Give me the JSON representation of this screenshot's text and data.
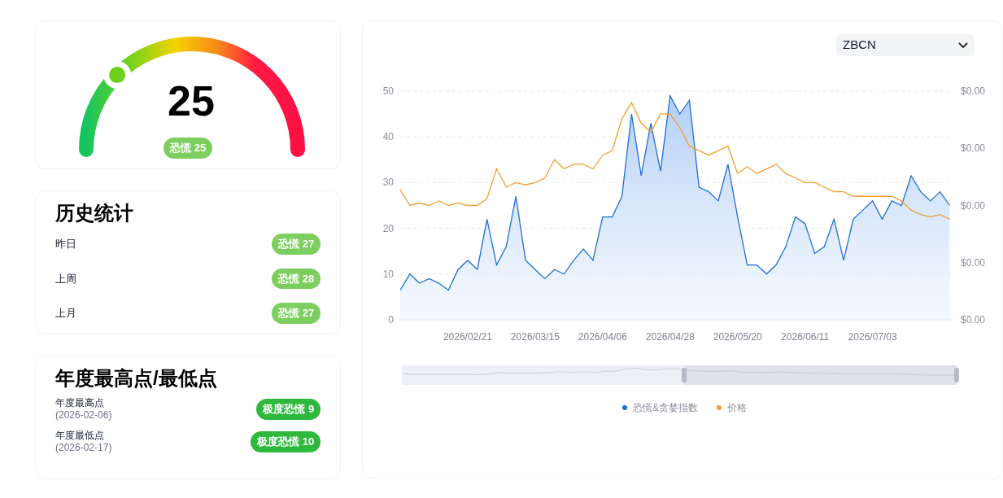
{
  "gauge": {
    "value": "25",
    "level": 0.25,
    "badge": {
      "label": "恐慌 25",
      "color": "#7ccf5e"
    }
  },
  "history": {
    "title": "历史统计",
    "rows": [
      {
        "label": "昨日",
        "badge": "恐慌 27",
        "color": "#7ccf5e"
      },
      {
        "label": "上周",
        "badge": "恐慌 28",
        "color": "#7ccf5e"
      },
      {
        "label": "上月",
        "badge": "恐慌 27",
        "color": "#7ccf5e"
      }
    ]
  },
  "yearly": {
    "title": "年度最高点/最低点",
    "rows": [
      {
        "label": "年度最高点",
        "date": "(2026-02-06)",
        "badge": "极度恐慌 9",
        "color": "#2eb83c"
      },
      {
        "label": "年度最低点",
        "date": "(2026-02-17)",
        "badge": "极度恐慌 10",
        "color": "#2eb83c"
      }
    ]
  },
  "chart_panel": {
    "selector": {
      "value": "ZBCN"
    },
    "right_axis_labels": [
      "$0.00",
      "$0.00",
      "$0.00",
      "$0.00",
      "$0.00"
    ],
    "chart_data": {
      "type": "area",
      "categories": [
        null,
        null,
        null,
        null,
        null,
        null,
        null,
        "2026/02/21",
        null,
        null,
        null,
        null,
        null,
        null,
        "2026/03/15",
        null,
        null,
        null,
        null,
        null,
        null,
        "2026/04/06",
        null,
        null,
        null,
        null,
        null,
        null,
        "2026/04/28",
        null,
        null,
        null,
        null,
        null,
        null,
        "2026/05/20",
        null,
        null,
        null,
        null,
        null,
        null,
        "2026/06/11",
        null,
        null,
        null,
        null,
        null,
        null,
        "2026/07/03",
        null,
        null,
        null,
        null,
        null,
        null,
        null,
        null
      ],
      "series": [
        {
          "name": "恐慌&贪婪指数",
          "type": "area",
          "color": "#1f6fd1",
          "values": [
            6.5,
            10,
            8,
            9,
            8,
            6.5,
            11,
            13,
            11,
            22,
            12,
            16,
            27,
            13,
            11,
            9,
            11,
            10,
            13,
            15.5,
            13,
            22.5,
            22.5,
            27,
            45,
            31.5,
            43,
            32.5,
            49,
            45,
            48,
            29,
            28,
            26,
            34,
            22.5,
            12,
            12,
            10,
            12,
            16,
            22.5,
            21,
            14.5,
            16,
            22,
            13,
            22,
            24,
            26,
            22,
            26,
            25,
            31.5,
            28,
            26,
            28,
            25
          ]
        },
        {
          "name": "价格",
          "type": "line",
          "color": "#f0a030",
          "values": [
            28.5,
            25,
            25.5,
            25,
            26,
            25,
            25.5,
            25,
            25,
            26.5,
            33,
            29,
            30,
            29.5,
            30,
            31,
            35,
            33,
            34,
            34,
            33,
            36,
            37,
            44,
            47.5,
            43,
            41,
            45,
            45,
            42,
            38,
            37,
            36,
            37,
            38,
            32,
            33.5,
            32,
            33,
            34,
            32,
            31,
            30,
            30,
            29,
            28,
            28,
            27,
            27,
            27,
            27,
            27,
            26,
            24,
            23,
            22.5,
            23,
            22
          ]
        }
      ],
      "ylim": [
        0,
        50
      ],
      "grid": true,
      "legend": true,
      "yticks": [
        0,
        10,
        20,
        30,
        40,
        50
      ]
    }
  }
}
